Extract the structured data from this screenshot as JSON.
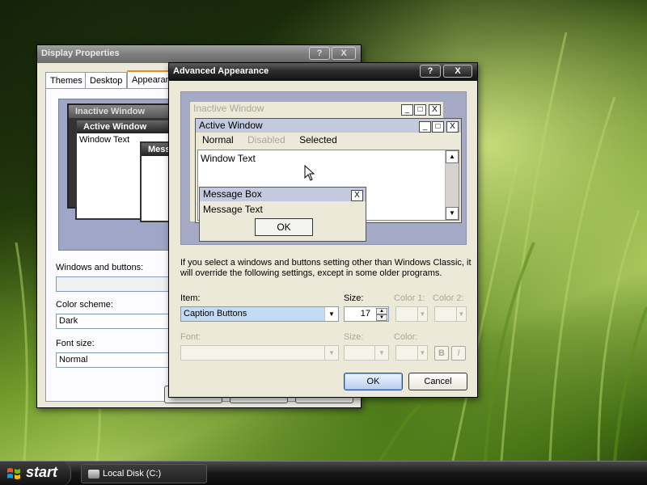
{
  "display_properties": {
    "title": "Display Properties",
    "help_glyph": "?",
    "close_glyph": "X",
    "tabs": [
      {
        "label": "Themes"
      },
      {
        "label": "Desktop"
      },
      {
        "label": "Appearance"
      }
    ],
    "preview": {
      "inactive_title": "Inactive Window",
      "active_title": "Active Window",
      "window_text": "Window Text",
      "message_title": "Message Box"
    },
    "windows_buttons_label": "Windows and buttons:",
    "windows_buttons_value": "",
    "color_scheme_label": "Color scheme:",
    "color_scheme_value": "Dark",
    "font_size_label": "Font size:",
    "font_size_value": "Normal"
  },
  "advanced_appearance": {
    "title": "Advanced Appearance",
    "help_glyph": "?",
    "close_glyph": "X",
    "preview": {
      "inactive_title": "Inactive Window",
      "active_title": "Active Window",
      "menu_items": [
        "Normal",
        "Disabled",
        "Selected"
      ],
      "window_text": "Window Text",
      "message_box_title": "Message Box",
      "message_text": "Message Text",
      "ok_label": "OK",
      "caption_glyphs": [
        "_",
        "□",
        "X"
      ]
    },
    "info_text": "If you select a windows and buttons setting other than Windows Classic, it will override the following settings, except in some older programs.",
    "item_label": "Item:",
    "item_value": "Caption Buttons",
    "size_label": "Size:",
    "size_value": "17",
    "color1_label": "Color 1:",
    "color2_label": "Color 2:",
    "font_label": "Font:",
    "font_size_label": "Size:",
    "font_color_label": "Color:",
    "bold_glyph": "B",
    "italic_glyph": "I",
    "ok_label": "OK",
    "cancel_label": "Cancel"
  },
  "taskbar": {
    "start_label": "start",
    "task_item_label": "Local Disk (C:)"
  }
}
